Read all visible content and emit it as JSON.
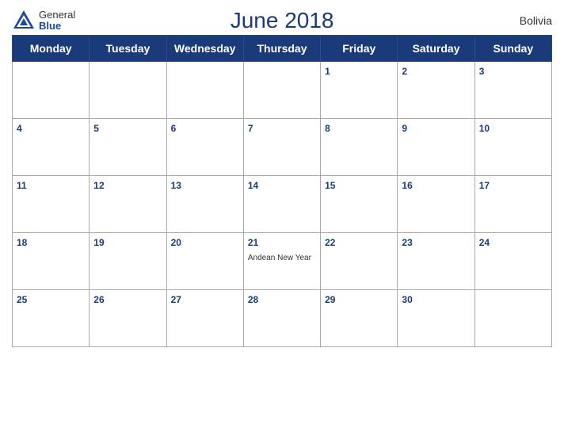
{
  "logo": {
    "general": "General",
    "blue": "Blue",
    "icon_color": "#1a4a9c"
  },
  "header": {
    "title": "June 2018",
    "country": "Bolivia"
  },
  "weekdays": [
    "Monday",
    "Tuesday",
    "Wednesday",
    "Thursday",
    "Friday",
    "Saturday",
    "Sunday"
  ],
  "weeks": [
    [
      null,
      null,
      null,
      null,
      "1",
      "2",
      "3"
    ],
    [
      "4",
      "5",
      "6",
      "7",
      "8",
      "9",
      "10"
    ],
    [
      "11",
      "12",
      "13",
      "14",
      "15",
      "16",
      "17"
    ],
    [
      "18",
      "19",
      "20",
      "21",
      "22",
      "23",
      "24"
    ],
    [
      "25",
      "26",
      "27",
      "28",
      "29",
      "30",
      null
    ]
  ],
  "events": {
    "21": "Andean New Year"
  },
  "colors": {
    "header_bg": "#1a3a7a",
    "border": "#aaaaaa",
    "date_color": "#1a3a7a"
  }
}
